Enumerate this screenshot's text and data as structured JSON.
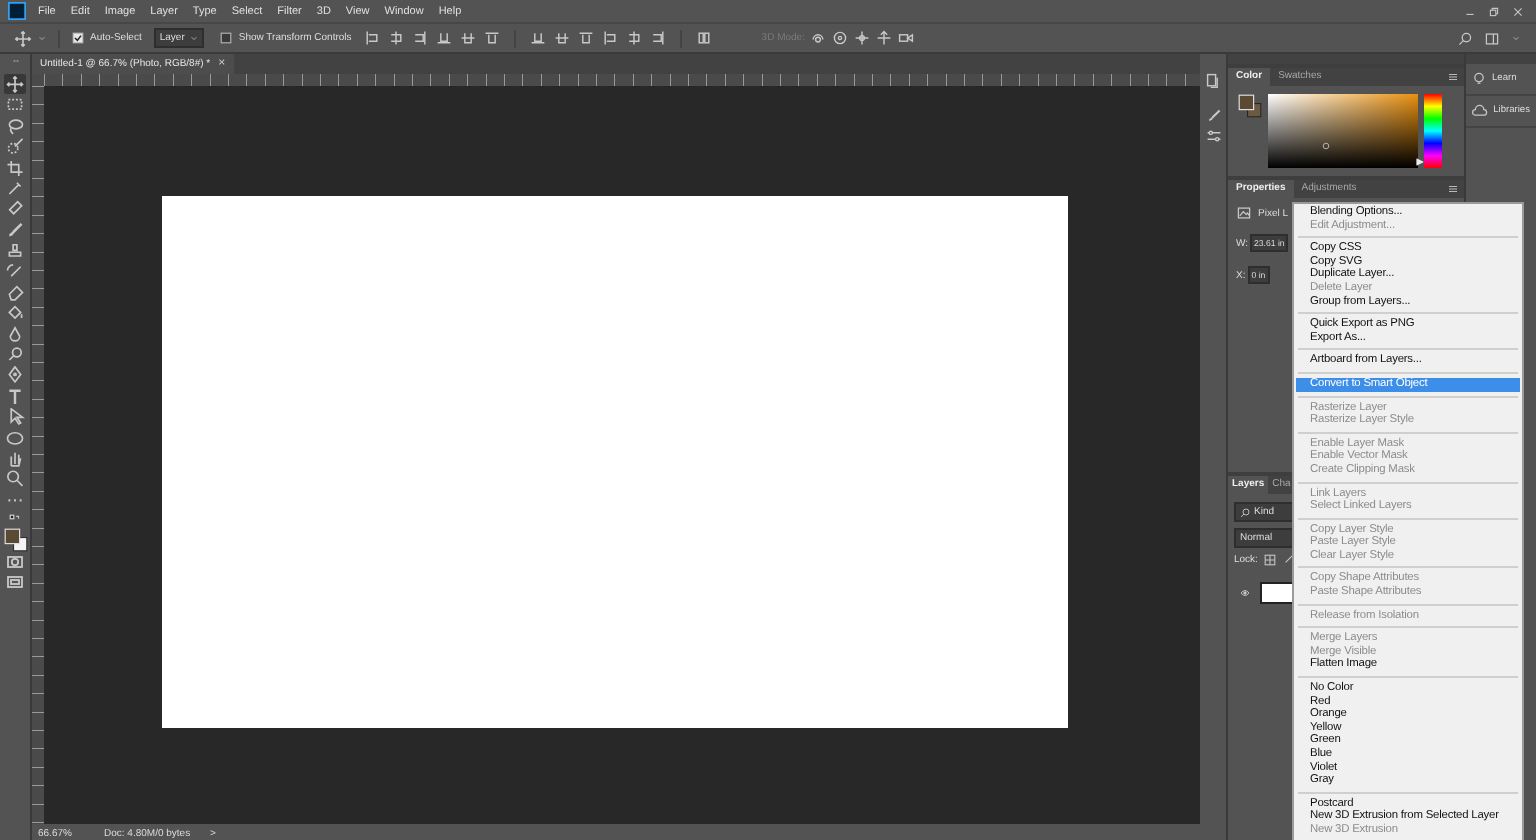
{
  "menu_bar": {
    "items": [
      "File",
      "Edit",
      "Image",
      "Layer",
      "Type",
      "Select",
      "Filter",
      "3D",
      "View",
      "Window",
      "Help"
    ]
  },
  "options_bar": {
    "auto_select": {
      "label": "Auto-Select",
      "checked": true
    },
    "target": {
      "value": "Layer"
    },
    "transform_controls": {
      "label": "Show Transform Controls",
      "checked": false
    },
    "mode_label": {
      "text": "3D Mode:",
      "disabled": true
    }
  },
  "tools": [
    {
      "kind": "move",
      "selected": true
    },
    {
      "kind": "marquee",
      "selected": false
    },
    {
      "kind": "lasso",
      "selected": false
    },
    {
      "kind": "quick-select",
      "selected": false
    },
    {
      "kind": "crop",
      "selected": false
    },
    {
      "kind": "eyedropper",
      "selected": false
    },
    {
      "kind": "healing",
      "selected": false
    },
    {
      "kind": "brush",
      "selected": false
    },
    {
      "kind": "stamp",
      "selected": false
    },
    {
      "kind": "history-brush",
      "selected": false
    },
    {
      "kind": "eraser",
      "selected": false
    },
    {
      "kind": "bucket",
      "selected": false
    },
    {
      "kind": "blur",
      "selected": false
    },
    {
      "kind": "dodge",
      "selected": false
    },
    {
      "kind": "pen",
      "selected": false
    },
    {
      "kind": "type",
      "selected": false
    },
    {
      "kind": "path-select",
      "selected": false
    },
    {
      "kind": "ellipse",
      "selected": false
    },
    {
      "kind": "hand",
      "selected": false
    },
    {
      "kind": "zoom",
      "selected": false
    },
    {
      "kind": "more",
      "selected": false
    }
  ],
  "document_tab": {
    "title": "Untitled-1 @ 66.7% (Photo, RGB/8#) *",
    "close": "×"
  },
  "status_bar": {
    "zoom": "66.67%",
    "doc_info": "Doc: 4.80M/0 bytes",
    "arrow": ">"
  },
  "color_panel": {
    "tabs": [
      {
        "label": "Color",
        "selected": true
      },
      {
        "label": "Swatches",
        "selected": false
      }
    ],
    "hue_slider": {
      "level": 0.09
    }
  },
  "properties_panel": {
    "tabs": [
      {
        "label": "Properties",
        "selected": true
      },
      {
        "label": "Adjustments",
        "selected": false
      }
    ],
    "heading": "Pixel L",
    "fields": [
      {
        "label": "W:",
        "value": "23.61 in"
      },
      {
        "label": "X:",
        "value": "0 in"
      }
    ]
  },
  "layers_panel": {
    "tabs": [
      {
        "label": "Layers",
        "selected": true
      },
      {
        "label": "Cha",
        "selected": false
      }
    ],
    "filter": "Kind",
    "blend_mode": "Normal",
    "lock_label": "Lock:"
  },
  "side_panels": [
    {
      "kind": "learn",
      "label": "Learn"
    },
    {
      "kind": "libraries",
      "label": "Libraries"
    }
  ],
  "context_menu": {
    "groups": [
      {
        "items": [
          {
            "label": "Blending Options...",
            "disabled": false,
            "selected": false
          },
          {
            "label": "Edit Adjustment...",
            "disabled": true,
            "selected": false
          }
        ]
      },
      {
        "items": [
          {
            "label": "Copy CSS",
            "disabled": false,
            "selected": false
          },
          {
            "label": "Copy SVG",
            "disabled": false,
            "selected": false
          },
          {
            "label": "Duplicate Layer...",
            "disabled": false,
            "selected": false
          },
          {
            "label": "Delete Layer",
            "disabled": true,
            "selected": false
          },
          {
            "label": "Group from Layers...",
            "disabled": false,
            "selected": false
          }
        ]
      },
      {
        "items": [
          {
            "label": "Quick Export as PNG",
            "disabled": false,
            "selected": false
          },
          {
            "label": "Export As...",
            "disabled": false,
            "selected": false
          }
        ]
      },
      {
        "items": [
          {
            "label": "Artboard from Layers...",
            "disabled": false,
            "selected": false
          }
        ]
      },
      {
        "items": [
          {
            "label": "Convert to Smart Object",
            "disabled": false,
            "selected": true
          }
        ]
      },
      {
        "items": [
          {
            "label": "Rasterize Layer",
            "disabled": true,
            "selected": false
          },
          {
            "label": "Rasterize Layer Style",
            "disabled": true,
            "selected": false
          }
        ]
      },
      {
        "items": [
          {
            "label": "Enable Layer Mask",
            "disabled": true,
            "selected": false
          },
          {
            "label": "Enable Vector Mask",
            "disabled": true,
            "selected": false
          },
          {
            "label": "Create Clipping Mask",
            "disabled": true,
            "selected": false
          }
        ]
      },
      {
        "items": [
          {
            "label": "Link Layers",
            "disabled": true,
            "selected": false
          },
          {
            "label": "Select Linked Layers",
            "disabled": true,
            "selected": false
          }
        ]
      },
      {
        "items": [
          {
            "label": "Copy Layer Style",
            "disabled": true,
            "selected": false
          },
          {
            "label": "Paste Layer Style",
            "disabled": true,
            "selected": false
          },
          {
            "label": "Clear Layer Style",
            "disabled": true,
            "selected": false
          }
        ]
      },
      {
        "items": [
          {
            "label": "Copy Shape Attributes",
            "disabled": true,
            "selected": false
          },
          {
            "label": "Paste Shape Attributes",
            "disabled": true,
            "selected": false
          }
        ]
      },
      {
        "items": [
          {
            "label": "Release from Isolation",
            "disabled": true,
            "selected": false
          }
        ]
      },
      {
        "items": [
          {
            "label": "Merge Layers",
            "disabled": true,
            "selected": false
          },
          {
            "label": "Merge Visible",
            "disabled": true,
            "selected": false
          },
          {
            "label": "Flatten Image",
            "disabled": false,
            "selected": false
          }
        ]
      },
      {
        "items": [
          {
            "label": "No Color",
            "disabled": false,
            "selected": false
          },
          {
            "label": "Red",
            "disabled": false,
            "selected": false
          },
          {
            "label": "Orange",
            "disabled": false,
            "selected": false
          },
          {
            "label": "Yellow",
            "disabled": false,
            "selected": false
          },
          {
            "label": "Green",
            "disabled": false,
            "selected": false
          },
          {
            "label": "Blue",
            "disabled": false,
            "selected": false
          },
          {
            "label": "Violet",
            "disabled": false,
            "selected": false
          },
          {
            "label": "Gray",
            "disabled": false,
            "selected": false
          }
        ]
      },
      {
        "items": [
          {
            "label": "Postcard",
            "disabled": false,
            "selected": false
          },
          {
            "label": "New 3D Extrusion from Selected Layer",
            "disabled": false,
            "selected": false
          },
          {
            "label": "New 3D Extrusion",
            "disabled": true,
            "selected": false
          }
        ]
      }
    ]
  }
}
